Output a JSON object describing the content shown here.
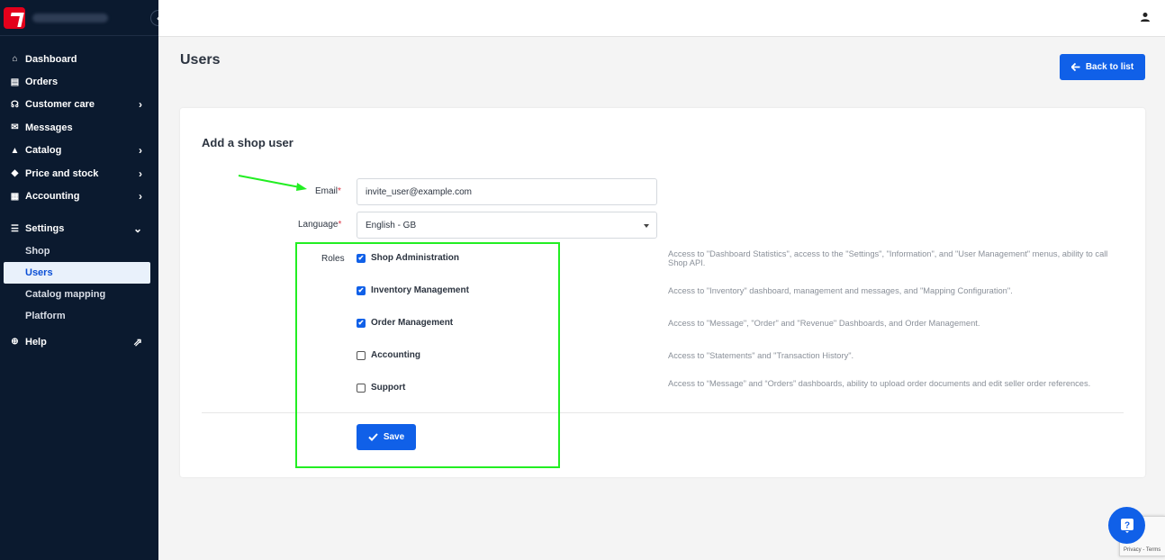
{
  "sidebar": {
    "items": [
      {
        "label": "Dashboard",
        "icon": "home-icon"
      },
      {
        "label": "Orders",
        "icon": "clipboard-icon"
      },
      {
        "label": "Customer care",
        "icon": "headset-icon"
      },
      {
        "label": "Messages",
        "icon": "message-icon"
      },
      {
        "label": "Catalog",
        "icon": "catalog-icon"
      },
      {
        "label": "Price and stock",
        "icon": "tag-icon"
      },
      {
        "label": "Accounting",
        "icon": "receipt-icon"
      },
      {
        "label": "Settings",
        "icon": "sliders-icon"
      },
      {
        "label": "Help",
        "icon": "lifebuoy-icon"
      }
    ],
    "settings_sub": [
      "Shop",
      "Users",
      "Catalog mapping",
      "Platform"
    ]
  },
  "page": {
    "title": "Users",
    "back_label": "Back to list"
  },
  "form": {
    "title": "Add a shop user",
    "email_label": "Email",
    "email_value": "invite_user@example.com",
    "language_label": "Language",
    "language_value": "English - GB",
    "roles_label": "Roles",
    "required_mark": "*",
    "save_label": "Save",
    "roles": [
      {
        "label": "Shop Administration",
        "checked": true,
        "desc": "Access to \"Dashboard Statistics\", access to the \"Settings\", \"Information\", and \"User Management\" menus, ability to call Shop API."
      },
      {
        "label": "Inventory Management",
        "checked": true,
        "desc": "Access to \"Inventory\" dashboard, management and messages, and \"Mapping Configuration\"."
      },
      {
        "label": "Order Management",
        "checked": true,
        "desc": "Access to \"Message\", \"Order\" and \"Revenue\" Dashboards, and Order Management."
      },
      {
        "label": "Accounting",
        "checked": false,
        "desc": "Access to \"Statements\" and \"Transaction History\"."
      },
      {
        "label": "Support",
        "checked": false,
        "desc": "Access to “Message” and “Orders” dashboards, ability to upload order documents and edit seller order references."
      }
    ]
  },
  "recaptcha": {
    "text": "Privacy - Terms"
  },
  "colors": {
    "accent": "#1060e8",
    "sidebar_bg": "#0b1a2f",
    "annotation": "#22ee22"
  }
}
